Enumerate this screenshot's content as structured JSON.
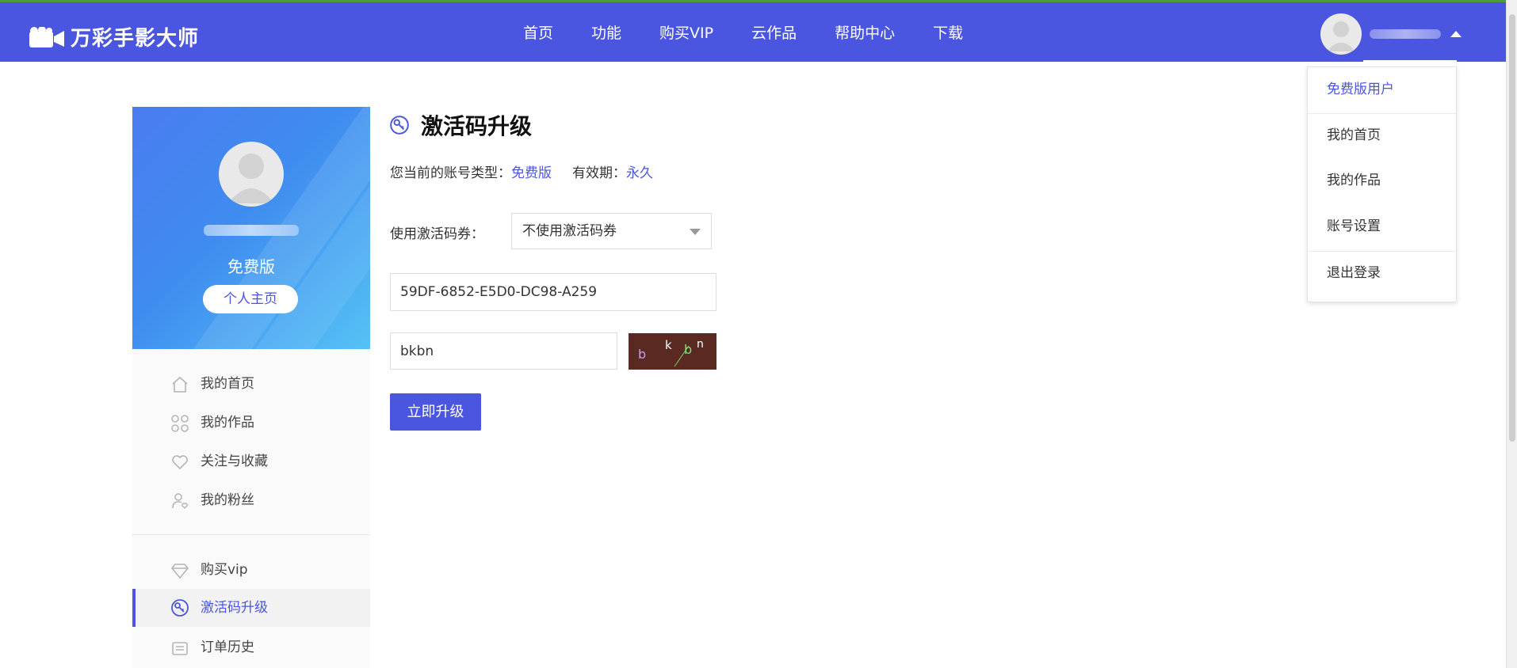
{
  "header": {
    "logo_text": "万彩手影大师",
    "nav": [
      "首页",
      "功能",
      "购买VIP",
      "云作品",
      "帮助中心",
      "下载"
    ]
  },
  "profile": {
    "tier": "免费版",
    "home_button": "个人主页"
  },
  "sidebar": {
    "items": [
      {
        "label": "我的首页",
        "icon": "home-icon"
      },
      {
        "label": "我的作品",
        "icon": "grid-icon"
      },
      {
        "label": "关注与收藏",
        "icon": "heart-icon"
      },
      {
        "label": "我的粉丝",
        "icon": "fans-icon"
      },
      {
        "label": "购买vip",
        "icon": "diamond-icon"
      },
      {
        "label": "激活码升级",
        "icon": "key-icon",
        "active": true
      },
      {
        "label": "订单历史",
        "icon": "order-icon"
      }
    ]
  },
  "main": {
    "title": "激活码升级",
    "account_type_label": "您当前的账号类型：",
    "account_type_value": "免费版",
    "validity_label": "有效期：",
    "validity_value": "永久",
    "voucher_label": "使用激活码券：",
    "voucher_selected": "不使用激活码券",
    "activation_code": "59DF-6852-E5D0-DC98-A259",
    "captcha_value": "bkbn",
    "captcha_chars": [
      "b",
      "k",
      "b",
      "n"
    ],
    "submit_label": "立即升级"
  },
  "dropdown": {
    "items": [
      "免费版用户",
      "我的首页",
      "我的作品",
      "账号设置",
      "退出登录"
    ]
  },
  "colors": {
    "brand": "#4a55e0",
    "captcha_bg": "#5a2a22"
  }
}
